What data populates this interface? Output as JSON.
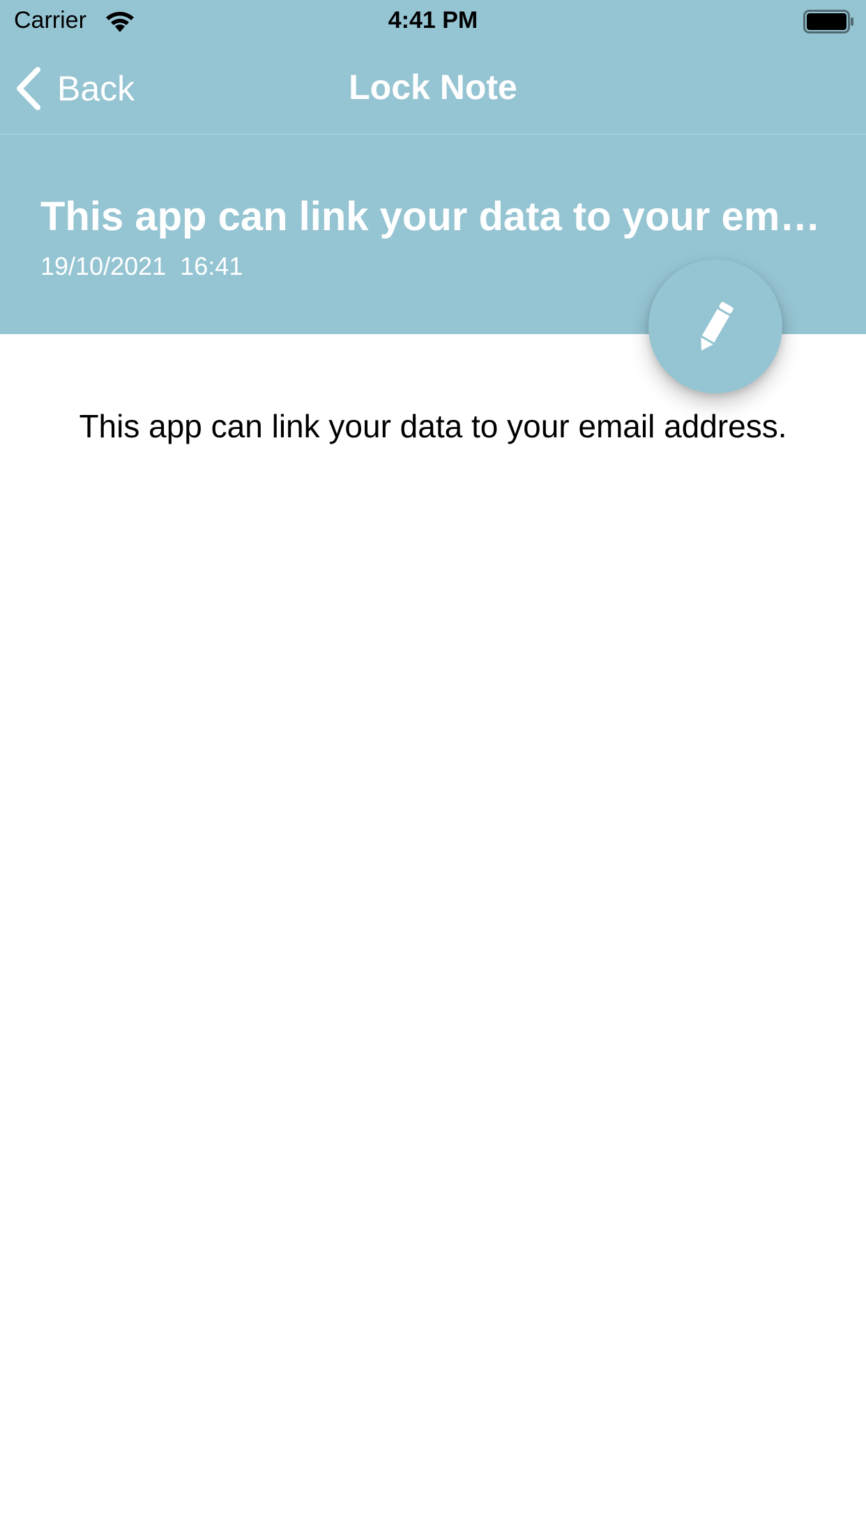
{
  "status_bar": {
    "carrier": "Carrier",
    "time": "4:41 PM",
    "icons": [
      "wifi-icon",
      "battery-icon"
    ]
  },
  "nav": {
    "back_label": "Back",
    "title": "Lock Note",
    "back_icon": "chevron-left-icon"
  },
  "note": {
    "title": "This app can link your data to your email address.",
    "date": "19/10/2021  16:41",
    "body": "This app can link your data to your email address."
  },
  "fab": {
    "icon": "pencil-icon"
  },
  "colors": {
    "accent": "#95c4d2",
    "text_on_accent": "#ffffff",
    "body_text": "#000000"
  }
}
